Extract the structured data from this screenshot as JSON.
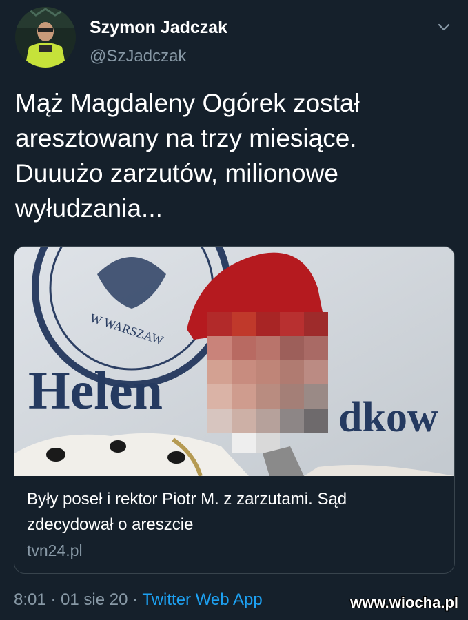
{
  "tweet": {
    "author_name": "Szymon Jadczak",
    "author_handle": "@SzJadczak",
    "text": "Mąż Magdaleny Ogórek został\naresztowany na trzy miesiące.\nDuuużo zarzutów, milionowe\nwyłudzania...",
    "more_icon": "chevron-down-icon"
  },
  "card": {
    "title": "Były poseł i rektor Piotr M. z zarzutami. Sąd\nzdecydował o areszcie",
    "domain": "tvn24.pl",
    "image_text_1": "Helen",
    "image_text_2": "dkow",
    "image_seal_text": "W WARSZAW"
  },
  "footer": {
    "time": "8:01",
    "sep1": " · ",
    "date": "01 sie 20",
    "sep2": " · ",
    "app": "Twitter Web App"
  },
  "watermark": "www.wiocha.pl"
}
